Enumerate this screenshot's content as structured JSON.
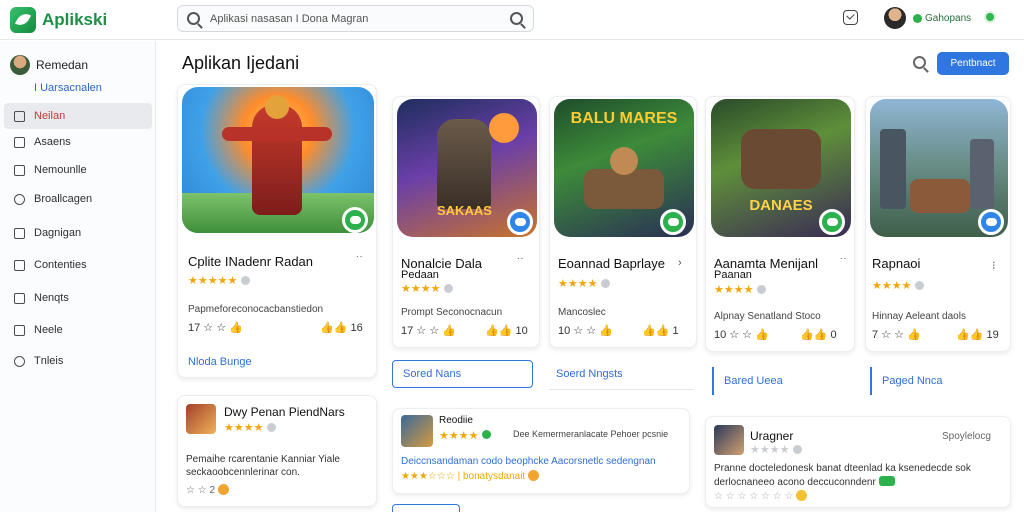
{
  "app": {
    "name": "Aplikski"
  },
  "search": {
    "placeholder": "Aplikasi nasasan I Dona Magran"
  },
  "user": {
    "name": "Gahopans"
  },
  "sidebar": {
    "profile_name": "Remedan",
    "profile_sub": "I Uarsacnalen",
    "items": [
      {
        "label": "Neilan",
        "icon": "checkbox-icon",
        "active": true
      },
      {
        "label": "Asaens",
        "icon": "checkbox-icon"
      },
      {
        "label": "Nemounlle",
        "icon": "checkbox-icon"
      },
      {
        "label": "Broallcagen",
        "icon": "circle-icon"
      },
      {
        "label": "Dagnigan",
        "icon": "checkbox-icon"
      },
      {
        "label": "Contenties",
        "icon": "checkbox-icon"
      },
      {
        "label": "Nenqts",
        "icon": "checkbox-icon"
      },
      {
        "label": "Neele",
        "icon": "checkbox-icon"
      },
      {
        "label": "Tnleis",
        "icon": "gear-icon"
      }
    ]
  },
  "main": {
    "title": "Aplikan Ijedani",
    "primary_button": "Pentbnact"
  },
  "apps": [
    {
      "title": "Cplite INadenr Radan",
      "stars": "★★★★★",
      "desc": "Papmeforeconocacbanstiedon",
      "stats_left": "17 ☆ ☆",
      "stats_right": "16",
      "action": "Nloda Bunge",
      "badge": "green"
    },
    {
      "title": "Nonalcie Dala",
      "subtitle": "Pedaan",
      "stars": "★★★★",
      "desc": "Prompt Seconocnacun",
      "stats_left": "17 ☆ ☆",
      "stats_right": "10",
      "action": "Sored Nans",
      "badge": "blue",
      "art_text": "SAKAAS"
    },
    {
      "title": "Eoannad Baprlaye",
      "stars": "★★★★",
      "desc": "Mancoslec",
      "stats_left": "10 ☆ ☆",
      "stats_right": "1",
      "action": "Soerd Nngsts",
      "badge": "green",
      "art_text": "BALU MARES"
    },
    {
      "title": "Aanamta Menijanl",
      "subtitle": "Paanan",
      "stars": "★★★★",
      "desc": "Alpnay Senatland Stoco",
      "stats_left": "10 ☆ ☆",
      "stats_right": "0",
      "action": "Bared Ueea",
      "badge": "green",
      "art_text": "DANAES"
    },
    {
      "title": "Rapnaoi",
      "stars": "★★★★",
      "desc": "Hinnay Aeleant daols",
      "stats_left": "7 ☆ ☆",
      "stats_right": "19",
      "action": "Paged Nnca",
      "badge": "blue"
    }
  ],
  "reviews": [
    {
      "name": "Dwy Penan PiendNars",
      "stars": "★★★★",
      "text_1": "Pemaihe rcarentanie Kanniar Yiale",
      "text_2": "seckaoobcennlerinar con.",
      "meta": "☆ ☆ 2"
    },
    {
      "name": "Reodiie",
      "stars": "★★★★",
      "meta_right": "Dee Kemermeranlacate Pehoer pcsnie",
      "text_1": "Deiccnsandaman codo beophcke Aacorsnetlc sedengnan",
      "text_2": "★★★☆☆☆ | bonatysdanait"
    },
    {
      "name": "Uragner",
      "stars": "★★★★",
      "meta_right": "Spoylelocg",
      "text_1": "Pranne docteledonesk banat dteenlad ka ksenedecde sok",
      "text_2": "derlocnaneeo acono deccuconndenr",
      "text_3": "☆ ☆ ☆ ☆ ☆ ☆ ☆"
    }
  ]
}
